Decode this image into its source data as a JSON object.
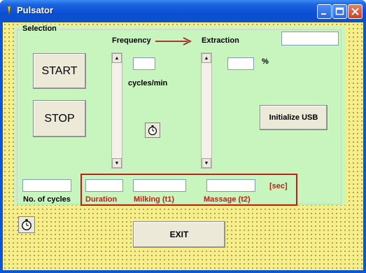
{
  "window": {
    "title": "Pulsator"
  },
  "selection": {
    "label": "Selection"
  },
  "frequency": {
    "label": "Frequency",
    "unit": "cycles/min",
    "value": ""
  },
  "extraction": {
    "label": "Extraction",
    "unit": "%",
    "value": ""
  },
  "buttons": {
    "start": "START",
    "stop": "STOP",
    "init_usb": "Initialize USB",
    "exit": "EXIT"
  },
  "fields": {
    "no_of_cycles": {
      "label": "No. of cycles",
      "value": ""
    },
    "duration": {
      "label": "Duration",
      "value": ""
    },
    "milking": {
      "label": "Milking (t1)",
      "value": ""
    },
    "massage": {
      "label": "Massage (t2)",
      "value": ""
    },
    "sec_unit": "[sec]"
  },
  "colors": {
    "titlebar": "#0a4fd3",
    "panel": "#c8f5bd",
    "client": "#f8ee88",
    "accent_red": "#c0201a"
  },
  "icons": [
    "app-icon",
    "minimize-icon",
    "maximize-icon",
    "close-icon",
    "stopwatch-icon",
    "arrow-right-icon",
    "scroll-up-icon",
    "scroll-down-icon"
  ]
}
